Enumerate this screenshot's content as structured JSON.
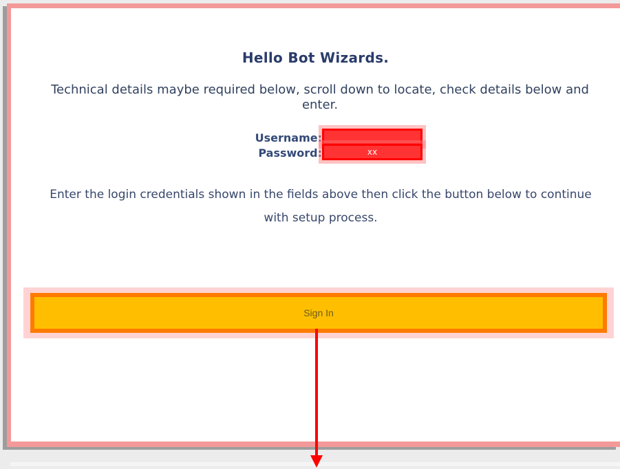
{
  "dialog": {
    "title": "Hello Bot Wizards.",
    "subtitle": "Technical details maybe required below, scroll down to locate, check details below and enter.",
    "username_label": "Username:",
    "password_label": "Password:",
    "username_value": "",
    "password_value": "xx",
    "notice": "Enter the login credentials shown in the fields above then click the button below to continue with setup process.",
    "submit_label": "Sign In"
  },
  "colors": {
    "card_border": "#f39999",
    "field_fill": "#ff3333",
    "button_fill": "#ffbf00",
    "button_border": "#ff7a00",
    "arrow": "#ff0000"
  },
  "icons": {
    "pointer": "down-arrow-icon"
  }
}
